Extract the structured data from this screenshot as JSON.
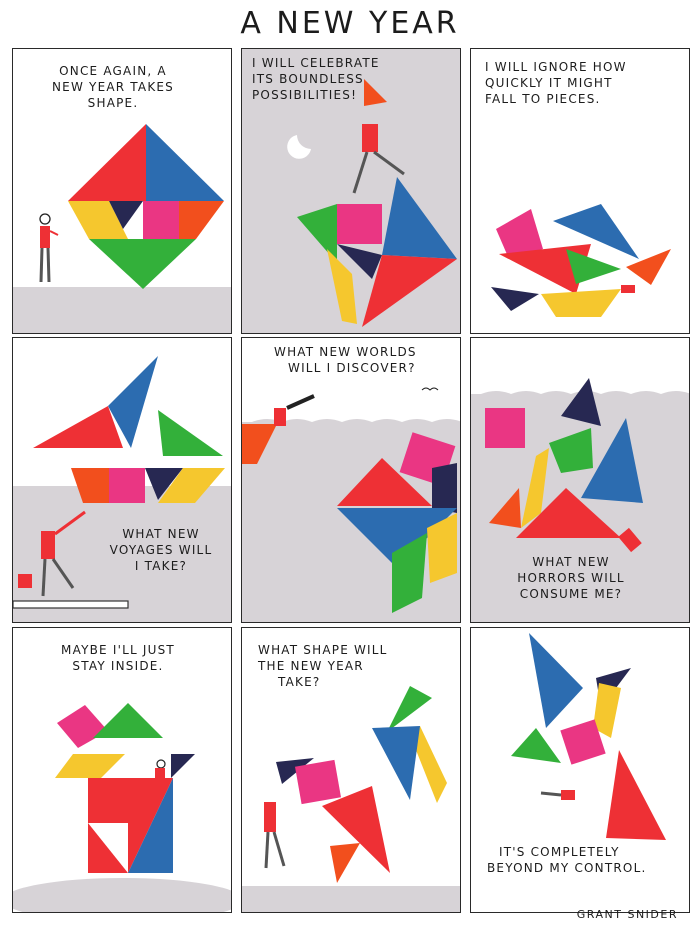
{
  "title": "A NEW YEAR",
  "credit": "GRANT SNIDER",
  "colors": {
    "red": "#ee3035",
    "blue": "#2c6cb0",
    "yellow": "#f5c72e",
    "green": "#33b03a",
    "pink": "#ea3683",
    "orange": "#f24f1d",
    "navy": "#272852",
    "gray": "#d7d3d7"
  },
  "panels": [
    {
      "caption": [
        "ONCE AGAIN, A",
        "NEW YEAR TAKES",
        "SHAPE."
      ]
    },
    {
      "caption": [
        "I WILL CELEBRATE",
        "ITS BOUNDLESS",
        "POSSIBILITIES!"
      ]
    },
    {
      "caption": [
        "I WILL IGNORE HOW",
        "QUICKLY IT MIGHT",
        "FALL TO PIECES."
      ]
    },
    {
      "caption": [
        "WHAT NEW",
        "VOYAGES WILL",
        "I TAKE?"
      ]
    },
    {
      "caption": [
        "WHAT NEW WORLDS",
        "WILL I DISCOVER?"
      ]
    },
    {
      "caption": [
        "WHAT NEW",
        "HORRORS WILL",
        "CONSUME ME?"
      ]
    },
    {
      "caption": [
        "MAYBE I'LL JUST",
        "STAY INSIDE."
      ]
    },
    {
      "caption": [
        "WHAT SHAPE WILL",
        "THE NEW YEAR",
        "TAKE?"
      ]
    },
    {
      "caption": [
        "IT'S COMPLETELY",
        "BEYOND MY CONTROL."
      ]
    }
  ]
}
